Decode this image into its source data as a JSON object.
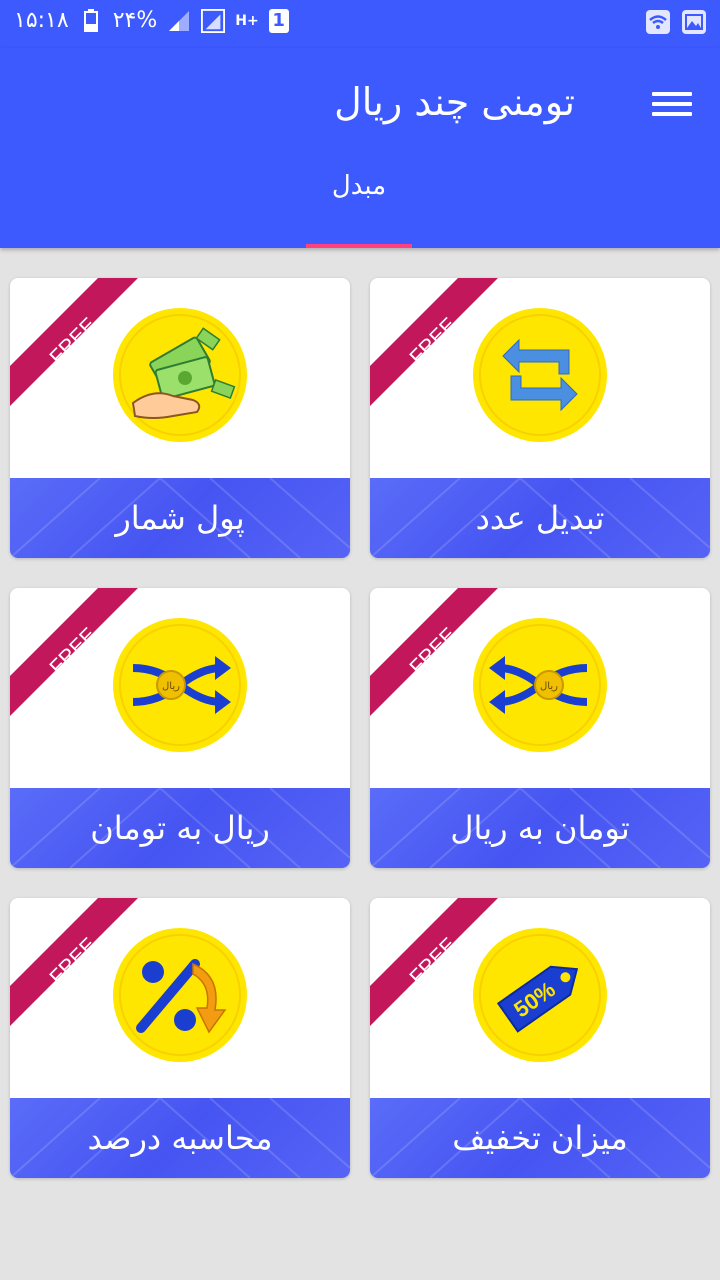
{
  "status_bar": {
    "time": "۱۵:۱۸",
    "battery": "۲۴%",
    "network": "H+",
    "sim": "1"
  },
  "app_bar": {
    "title": "تومنی چند ریال",
    "tab_label": "مبدل"
  },
  "badge_text": "FREE",
  "cards": [
    {
      "label": "پول شمار",
      "icon": "money-hand-icon"
    },
    {
      "label": "تبدیل عدد",
      "icon": "exchange-arrows-icon"
    },
    {
      "label": "ریال به تومان",
      "icon": "rial-to-toman-icon"
    },
    {
      "label": "تومان به ریال",
      "icon": "toman-to-rial-icon"
    },
    {
      "label": "محاسبه درصد",
      "icon": "percent-icon"
    },
    {
      "label": "میزان تخفیف",
      "icon": "discount-tag-icon"
    }
  ],
  "icon_texts": {
    "rial_coin": "ریال",
    "discount": "50%"
  },
  "colors": {
    "primary": "#3d5afe",
    "accent": "#ff4081",
    "ribbon": "#c2185b",
    "icon_circle": "#ffe600",
    "background": "#e3e3e3"
  }
}
